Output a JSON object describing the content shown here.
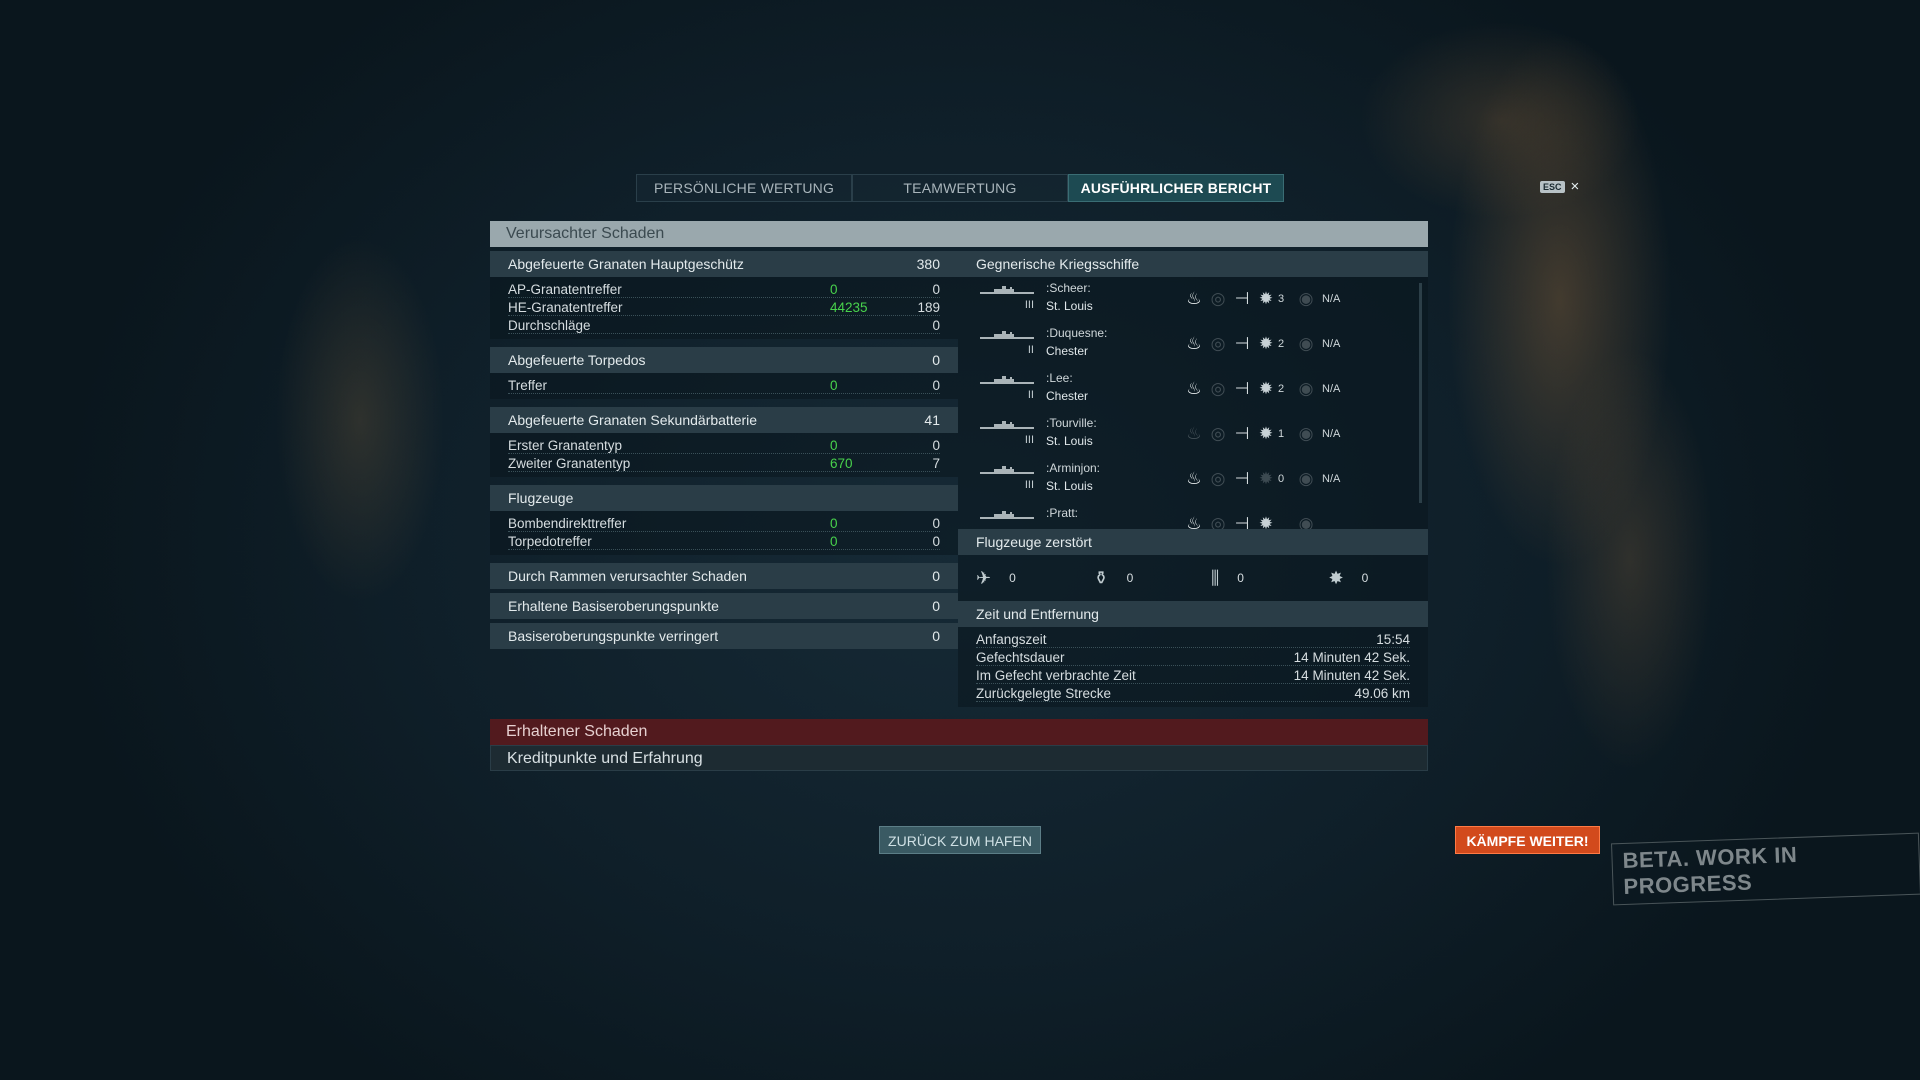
{
  "tabs": [
    "PERSÖNLICHE WERTUNG",
    "TEAMWERTUNG",
    "AUSFÜHRLICHER BERICHT"
  ],
  "esc_key": "ESC",
  "close_icon": "×",
  "damage_section": "Verursachter Schaden",
  "main_battery": {
    "title": "Abgefeuerte Granaten Hauptgeschütz",
    "value": "380",
    "rows": [
      {
        "label": "AP-Granatentreffer",
        "green": "0",
        "value": "0"
      },
      {
        "label": "HE-Granatentreffer",
        "green": "44235",
        "value": "189"
      },
      {
        "label": "Durchschläge",
        "green": "",
        "value": "0"
      }
    ]
  },
  "torpedoes": {
    "title": "Abgefeuerte Torpedos",
    "value": "0",
    "rows": [
      {
        "label": "Treffer",
        "green": "0",
        "value": "0"
      }
    ]
  },
  "secondary": {
    "title": "Abgefeuerte Granaten Sekundärbatterie",
    "value": "41",
    "rows": [
      {
        "label": "Erster Granatentyp",
        "green": "0",
        "value": "0"
      },
      {
        "label": "Zweiter Granatentyp",
        "green": "670",
        "value": "7"
      }
    ]
  },
  "aircraft": {
    "title": "Flugzeuge",
    "value": "",
    "rows": [
      {
        "label": "Bombendirekttreffer",
        "green": "0",
        "value": "0"
      },
      {
        "label": "Torpedotreffer",
        "green": "0",
        "value": "0"
      }
    ]
  },
  "ramming": {
    "title": "Durch Rammen verursachter Schaden",
    "value": "0"
  },
  "capture": {
    "title": "Erhaltene Basiseroberungspunkte",
    "value": "0"
  },
  "capture_reduced": {
    "title": "Basiseroberungspunkte verringert",
    "value": "0"
  },
  "enemy_ships": {
    "title": "Gegnerische Kriegsschiffe",
    "ships": [
      {
        "player": ":Scheer:",
        "tier": "III",
        "ship": "St. Louis",
        "fire": true,
        "crit": "3",
        "na": "N/A"
      },
      {
        "player": ":Duquesne:",
        "tier": "II",
        "ship": "Chester",
        "fire": true,
        "crit": "2",
        "na": "N/A"
      },
      {
        "player": ":Lee:",
        "tier": "II",
        "ship": "Chester",
        "fire": true,
        "crit": "2",
        "na": "N/A"
      },
      {
        "player": ":Tourville:",
        "tier": "III",
        "ship": "St. Louis",
        "fire": false,
        "crit": "1",
        "na": "N/A"
      },
      {
        "player": ":Arminjon:",
        "tier": "III",
        "ship": "St. Louis",
        "fire": true,
        "crit": "0",
        "na": "N/A"
      },
      {
        "player": ":Pratt:",
        "tier": "",
        "ship": "",
        "fire": true,
        "crit": "",
        "na": ""
      }
    ]
  },
  "planes_destroyed": {
    "title": "Flugzeuge zerstört",
    "items": [
      {
        "icon": "fighter-plane-icon",
        "value": "0"
      },
      {
        "icon": "torpedo-bomber-icon",
        "value": "0"
      },
      {
        "icon": "dive-bomber-icon",
        "value": "0"
      },
      {
        "icon": "aa-icon",
        "value": "0"
      }
    ]
  },
  "time": {
    "title": "Zeit und Entfernung",
    "rows": [
      {
        "label": "Anfangszeit",
        "value": "15:54"
      },
      {
        "label": "Gefechtsdauer",
        "value": "14 Minuten 42 Sek."
      },
      {
        "label": "Im Gefecht verbrachte Zeit",
        "value": "14 Minuten 42 Sek."
      },
      {
        "label": "Zurückgelegte Strecke",
        "value": "49.06 km"
      }
    ]
  },
  "received_damage": "Erhaltener Schaden",
  "credits_xp": "Kreditpunkte und Erfahrung",
  "back_button": "ZURÜCK ZUM HAFEN",
  "fight_button": "KÄMPFE WEITER!",
  "beta_label": "BETA. WORK IN PROGRESS",
  "colors": {
    "accent": "#d24a1c",
    "green": "#48d24c",
    "received": "#521a1e"
  }
}
